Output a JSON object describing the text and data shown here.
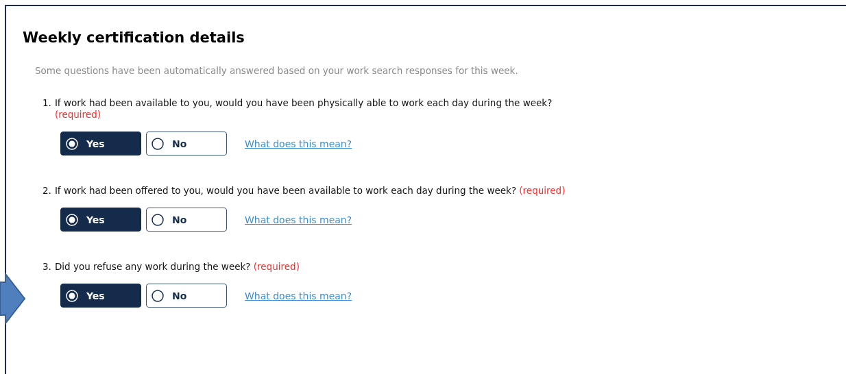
{
  "title": "Weekly certification details",
  "intro": "Some questions have been automatically answered based on your work search responses for this week.",
  "questions": [
    {
      "number": "1.",
      "text": "If work had been available to you, would you have been physically able to work each day during the week?",
      "required": "(required)",
      "options": [
        {
          "label": "Yes",
          "selected": true
        },
        {
          "label": "No",
          "selected": false
        }
      ],
      "help_link": "What does this mean?"
    },
    {
      "number": "2.",
      "text": "If work had been offered to you, would you have been available to work each day during the week?",
      "required": "(required)",
      "options": [
        {
          "label": "Yes",
          "selected": true
        },
        {
          "label": "No",
          "selected": false
        }
      ],
      "help_link": "What does this mean?"
    },
    {
      "number": "3.",
      "text": "Did you refuse any work during the week?",
      "required": "(required)",
      "options": [
        {
          "label": "Yes",
          "selected": true
        },
        {
          "label": "No",
          "selected": false
        }
      ],
      "help_link": "What does this mean?"
    }
  ]
}
